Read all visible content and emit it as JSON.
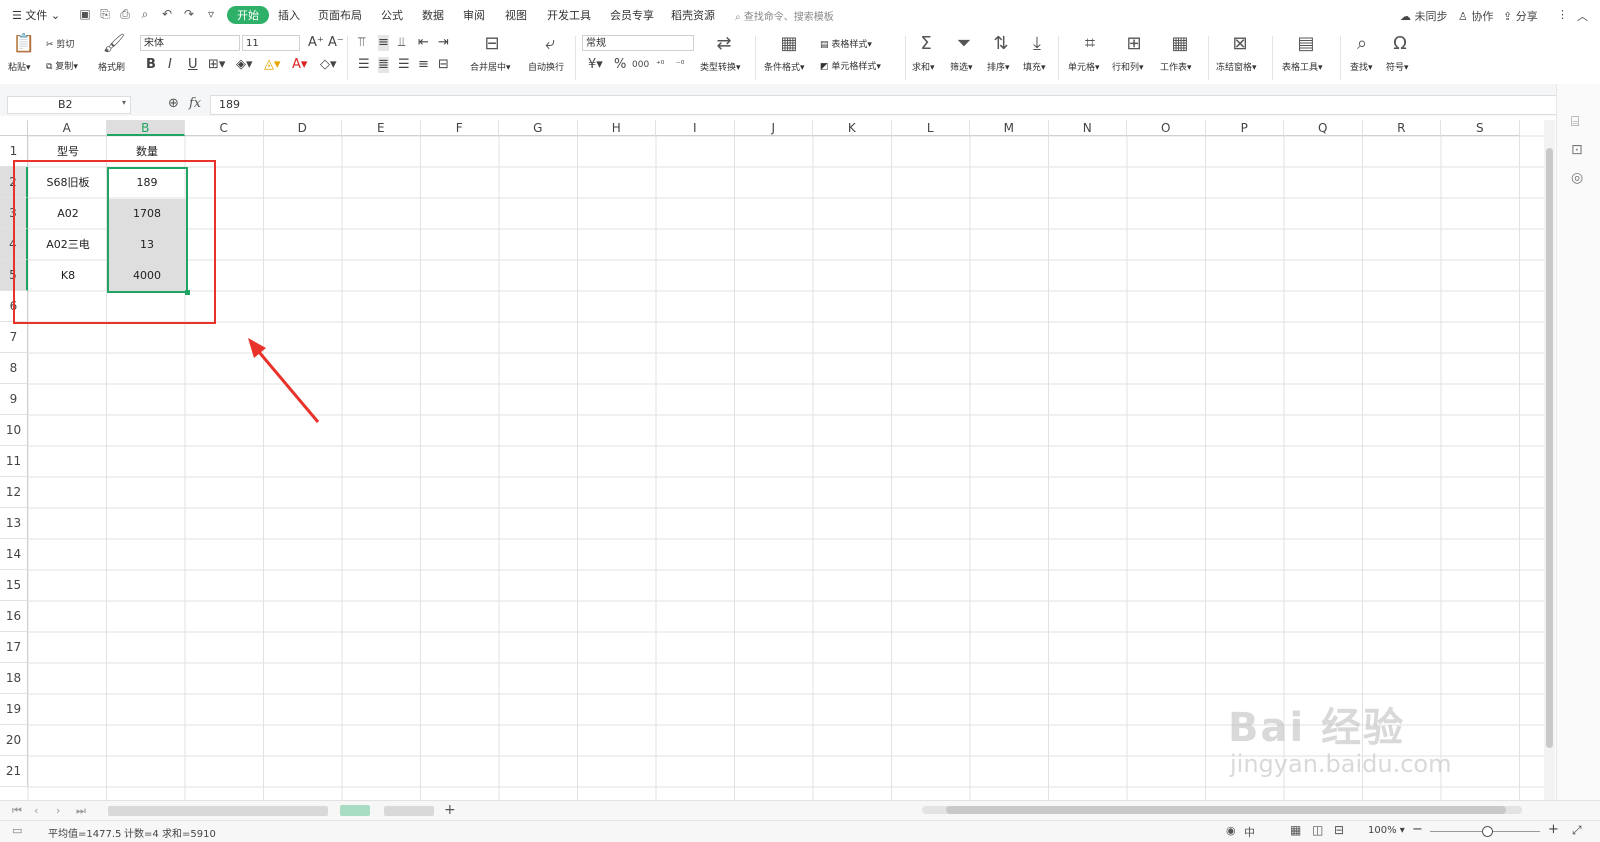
{
  "topbar": {
    "file_menu": "☰ 文件 ⌄",
    "tabs": [
      "插入",
      "页面布局",
      "公式",
      "数据",
      "审阅",
      "视图",
      "开发工具",
      "会员专享",
      "稻壳资源"
    ],
    "active_tab": "开始",
    "search_placeholder": "查找命令、搜索模板",
    "unsynced": "未同步",
    "collab": "协作",
    "share": "分享"
  },
  "ribbon": {
    "paste": "粘贴",
    "cut": "剪切",
    "copy": "复制",
    "format_painter": "格式刷",
    "font_name": "宋体",
    "font_size": "11",
    "merge_center": "合并居中",
    "auto_wrap": "自动换行",
    "number_format": "常规",
    "type_convert": "类型转换",
    "conditional_format": "条件格式",
    "table_style": "表格样式",
    "cell_style": "单元格样式",
    "sum": "求和",
    "filter": "筛选",
    "sort": "排序",
    "fill": "填充",
    "cell": "单元格",
    "row_col": "行和列",
    "worksheet": "工作表",
    "freeze": "冻结窗格",
    "table_tools": "表格工具",
    "find": "查找",
    "symbol": "符号",
    "currency": "¥",
    "percent": "%",
    "thousands": "000"
  },
  "formula_bar": {
    "name_box": "B2",
    "fx_label": "fx",
    "value": "189"
  },
  "grid": {
    "columns": [
      "A",
      "B",
      "C",
      "D",
      "E",
      "F",
      "G",
      "H",
      "I",
      "J",
      "K",
      "L",
      "M",
      "N",
      "O",
      "P",
      "Q",
      "R",
      "S"
    ],
    "rows": [
      "1",
      "2",
      "3",
      "4",
      "5",
      "6",
      "7",
      "8",
      "9",
      "10",
      "11",
      "12",
      "13",
      "14",
      "15",
      "16",
      "17",
      "18",
      "19",
      "20",
      "21"
    ],
    "header": {
      "a": "型号",
      "b": "数量"
    },
    "data": [
      {
        "a": "S68旧板",
        "b": "189"
      },
      {
        "a": "A02",
        "b": "1708"
      },
      {
        "a": "A02三电",
        "b": "13"
      },
      {
        "a": "K8",
        "b": "4000"
      }
    ]
  },
  "status": {
    "average": "平均值=1477.5",
    "count": "计数=4",
    "sum": "求和=5910",
    "zoom": "100%",
    "input_mode": "中"
  },
  "watermark": {
    "brand": "Bai 经验",
    "url": "jingyan.baidu.com"
  },
  "colors": {
    "accent": "#2fb069",
    "selection": "#1fa463",
    "annotation": "#e8322a"
  }
}
